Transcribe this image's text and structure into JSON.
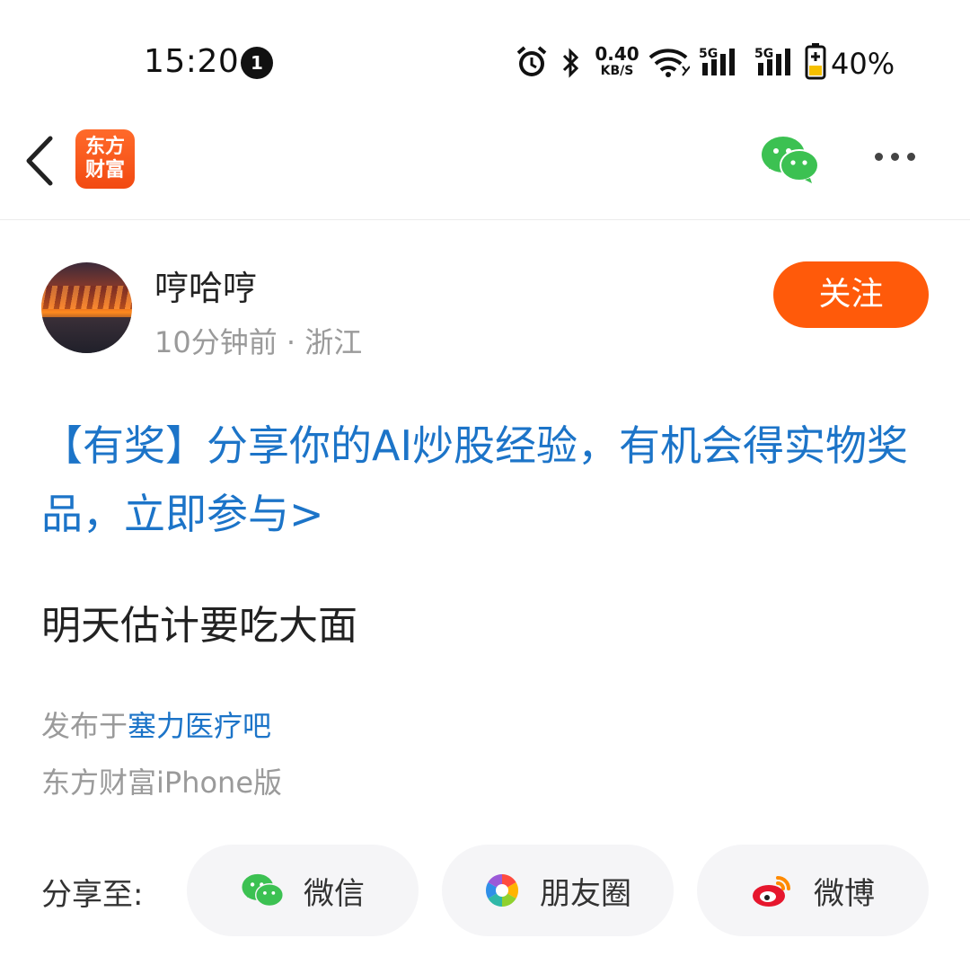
{
  "status_bar": {
    "time": "15:20",
    "notification_count": "1",
    "net_speed_value": "0.40",
    "net_speed_unit": "KB/S",
    "signal1": "5G",
    "signal2": "5G",
    "battery": "40%"
  },
  "nav": {
    "logo_line1": "东方",
    "logo_line2": "财富",
    "icons": [
      "back-icon",
      "wechat-icon",
      "more-icon"
    ]
  },
  "author": {
    "name": "哼哈哼",
    "meta": "10分钟前 · 浙江",
    "follow_label": "关注"
  },
  "post": {
    "promo": "【有奖】分享你的AI炒股经验，有机会得实物奖品，立即参与>",
    "text": "明天估计要吃大面",
    "source_prefix": "发布于",
    "source_link": "塞力医疗吧",
    "device": "东方财富iPhone版"
  },
  "share": {
    "label": "分享至:",
    "buttons": [
      {
        "label": "微信",
        "icon": "wechat-icon"
      },
      {
        "label": "朋友圈",
        "icon": "moments-icon"
      },
      {
        "label": "微博",
        "icon": "weibo-icon"
      }
    ]
  },
  "colors": {
    "accent_orange": "#ff5a0a",
    "link_blue": "#1c74c8",
    "wechat_green": "#3cc152"
  }
}
